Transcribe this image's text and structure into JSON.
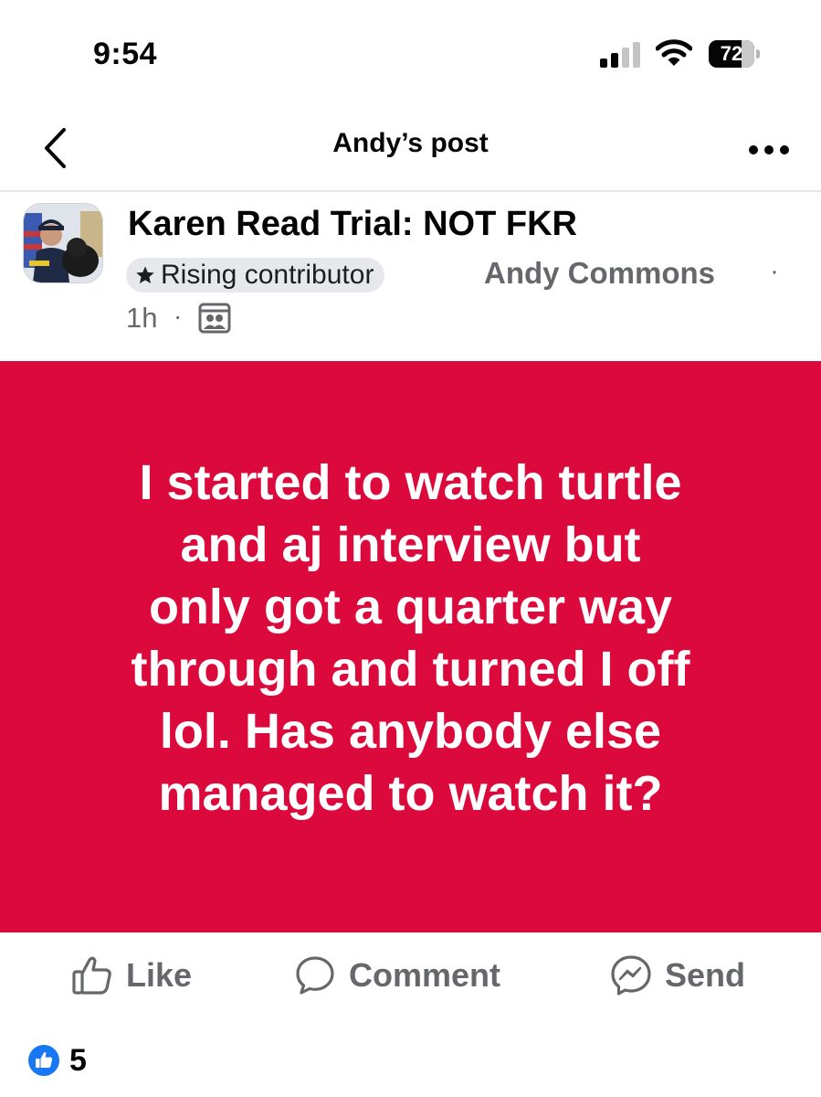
{
  "status_bar": {
    "time": "9:54",
    "battery": "72",
    "battery_level_percent": 72,
    "icons": [
      "signal-icon",
      "wifi-icon",
      "battery-icon"
    ]
  },
  "header": {
    "title": "Andy’s post",
    "back_icon": "chevron-left-icon",
    "more_icon": "more-dots-icon"
  },
  "post": {
    "group_name": "Karen Read Trial:  NOT FKR",
    "badge_label": "Rising contributor",
    "badge_icon": "star-icon",
    "author": "Andy Commons",
    "separator": "·",
    "time": "1h",
    "audience_icon": "group-members-icon",
    "text": "I started to watch turtle\nand aj interview but\nonly got a quarter way\nthrough and turned I off\nlol. Has anybody else\nmanaged to watch it?",
    "background_color": "#dc0a3c"
  },
  "actions": {
    "like_label": "Like",
    "comment_label": "Comment",
    "send_label": "Send",
    "like_icon": "thumbs-up-icon",
    "comment_icon": "comment-bubble-icon",
    "send_icon": "messenger-icon"
  },
  "reactions": {
    "icon": "like-reaction-icon",
    "count": "5"
  },
  "colors": {
    "post_background": "#dc0a3c",
    "secondary_text": "#65676b",
    "like_blue": "#1877f2"
  }
}
